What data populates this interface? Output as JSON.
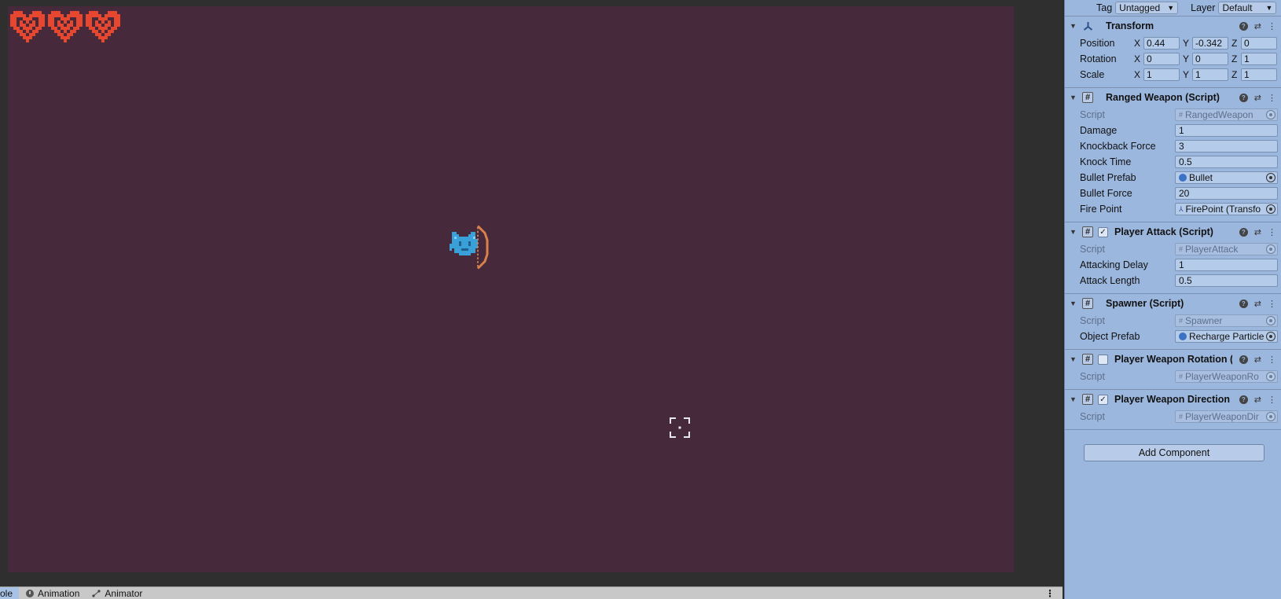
{
  "bottom_tabs": {
    "items": [
      {
        "label": "ole",
        "active": true
      },
      {
        "label": "Animation",
        "active": false
      },
      {
        "label": "Animator",
        "active": false
      }
    ]
  },
  "inspector": {
    "tag_label": "Tag",
    "tag_value": "Untagged",
    "layer_label": "Layer",
    "layer_value": "Default",
    "transform": {
      "title": "Transform",
      "position_label": "Position",
      "rotation_label": "Rotation",
      "scale_label": "Scale",
      "position": {
        "x": "0.44",
        "y": "-0.342",
        "z": "0"
      },
      "rotation": {
        "x": "0",
        "y": "0",
        "z": "1"
      },
      "scale": {
        "x": "1",
        "y": "1",
        "z": "1"
      }
    },
    "ranged_weapon": {
      "title": "Ranged Weapon (Script)",
      "script_label": "Script",
      "script_value": "RangedWeapon",
      "damage_label": "Damage",
      "damage": "1",
      "knockback_label": "Knockback Force",
      "knockback": "3",
      "knock_time_label": "Knock Time",
      "knock_time": "0.5",
      "bullet_prefab_label": "Bullet Prefab",
      "bullet_prefab": "Bullet",
      "bullet_force_label": "Bullet Force",
      "bullet_force": "20",
      "fire_point_label": "Fire Point",
      "fire_point": "FirePoint (Transfo"
    },
    "player_attack": {
      "title": "Player Attack (Script)",
      "script_label": "Script",
      "script_value": "PlayerAttack",
      "attacking_delay_label": "Attacking Delay",
      "attacking_delay": "1",
      "attack_length_label": "Attack Length",
      "attack_length": "0.5"
    },
    "spawner": {
      "title": "Spawner (Script)",
      "script_label": "Script",
      "script_value": "Spawner",
      "object_prefab_label": "Object Prefab",
      "object_prefab": "Recharge Particle"
    },
    "weapon_rotation": {
      "title": "Player Weapon Rotation (S",
      "script_label": "Script",
      "script_value": "PlayerWeaponRo"
    },
    "weapon_direction": {
      "title": "Player Weapon Direction (",
      "script_label": "Script",
      "script_value": "PlayerWeaponDir"
    },
    "add_component": "Add Component"
  },
  "colors": {
    "game_bg": "#462a3b",
    "heart": "#e6472e",
    "player": "#3aa0d8",
    "bow": "#d9814a",
    "inspector_bg": "#9cb7de"
  }
}
